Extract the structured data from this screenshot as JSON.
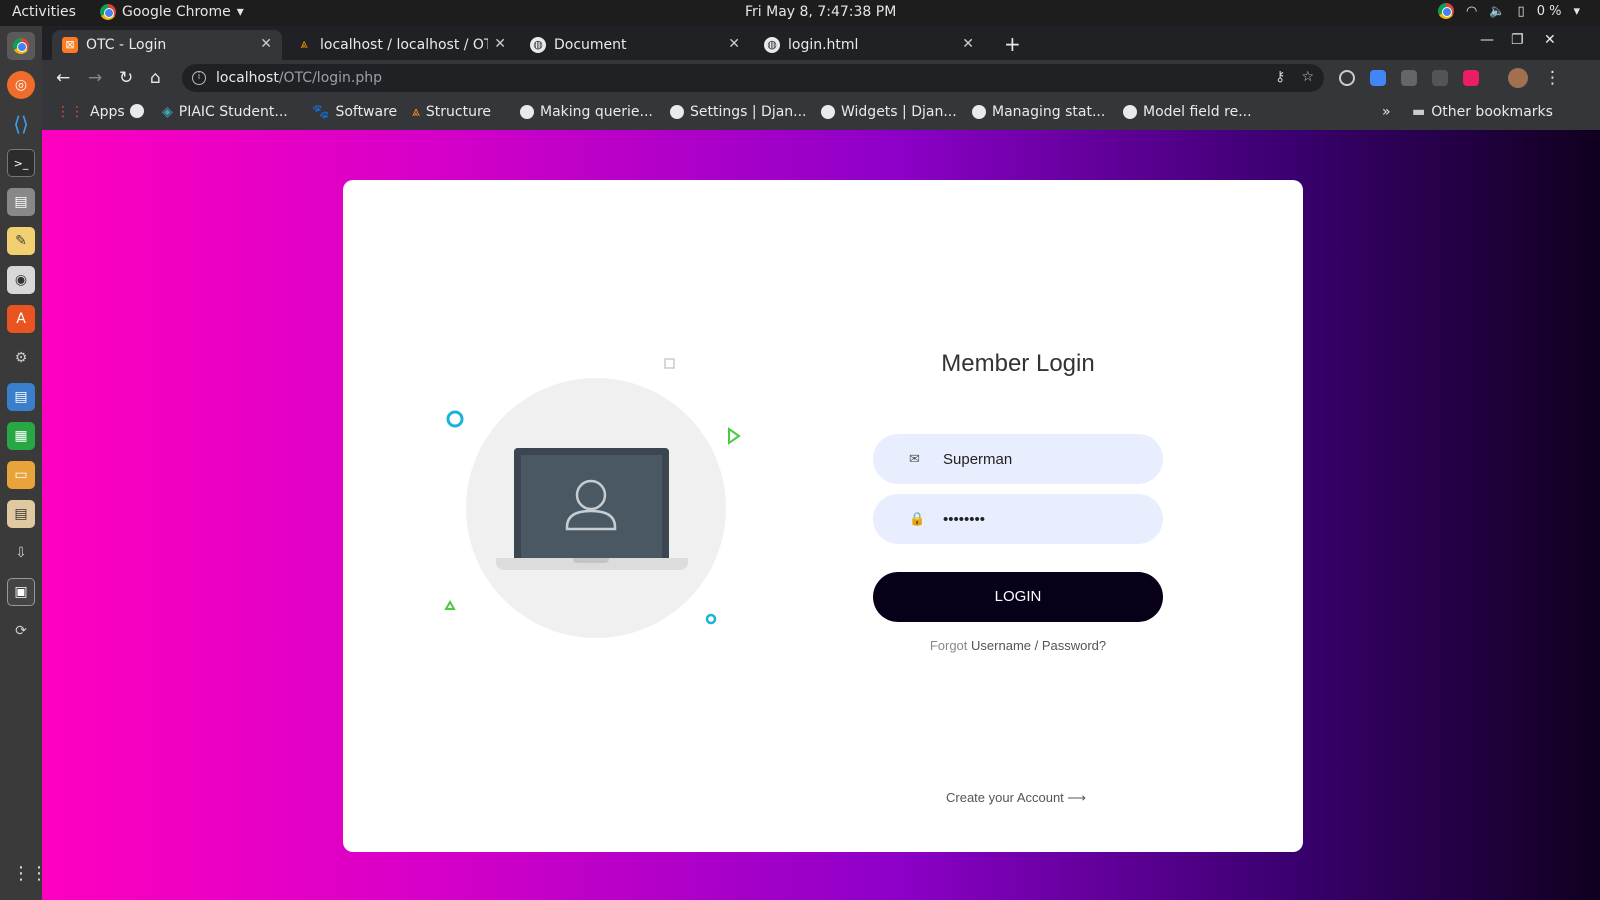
{
  "topbar": {
    "activities": "Activities",
    "app": "Google Chrome",
    "clock": "Fri May  8,  7:47:38 PM",
    "battery": "0 %"
  },
  "tabs": [
    {
      "title": "OTC - Login",
      "active": true
    },
    {
      "title": "localhost / localhost / OTC",
      "active": false
    },
    {
      "title": "Document",
      "active": false
    },
    {
      "title": "login.html",
      "active": false
    }
  ],
  "address": {
    "host": "localhost",
    "path": "/OTC/login.php"
  },
  "bookmarks": {
    "items": [
      "Apps",
      "",
      "PIAIC Student...",
      "Software",
      "Structure",
      "Making querie...",
      "Settings | Djan...",
      "Widgets | Djan...",
      "Managing stat...",
      "Model field re..."
    ],
    "other": "Other bookmarks",
    "more": "»"
  },
  "login": {
    "title": "Member Login",
    "username_value": "Superman",
    "password_value": "••••••••",
    "button": "LOGIN",
    "forgot_prefix": "Forgot",
    "forgot_link": "Username / Password?",
    "create": "Create your Account",
    "create_arrow": "⟶"
  },
  "colors": {
    "accent": "#080018",
    "field_bg": "#e8eefd",
    "gradient_start": "#ff00c0",
    "gradient_end": "#10001f"
  }
}
